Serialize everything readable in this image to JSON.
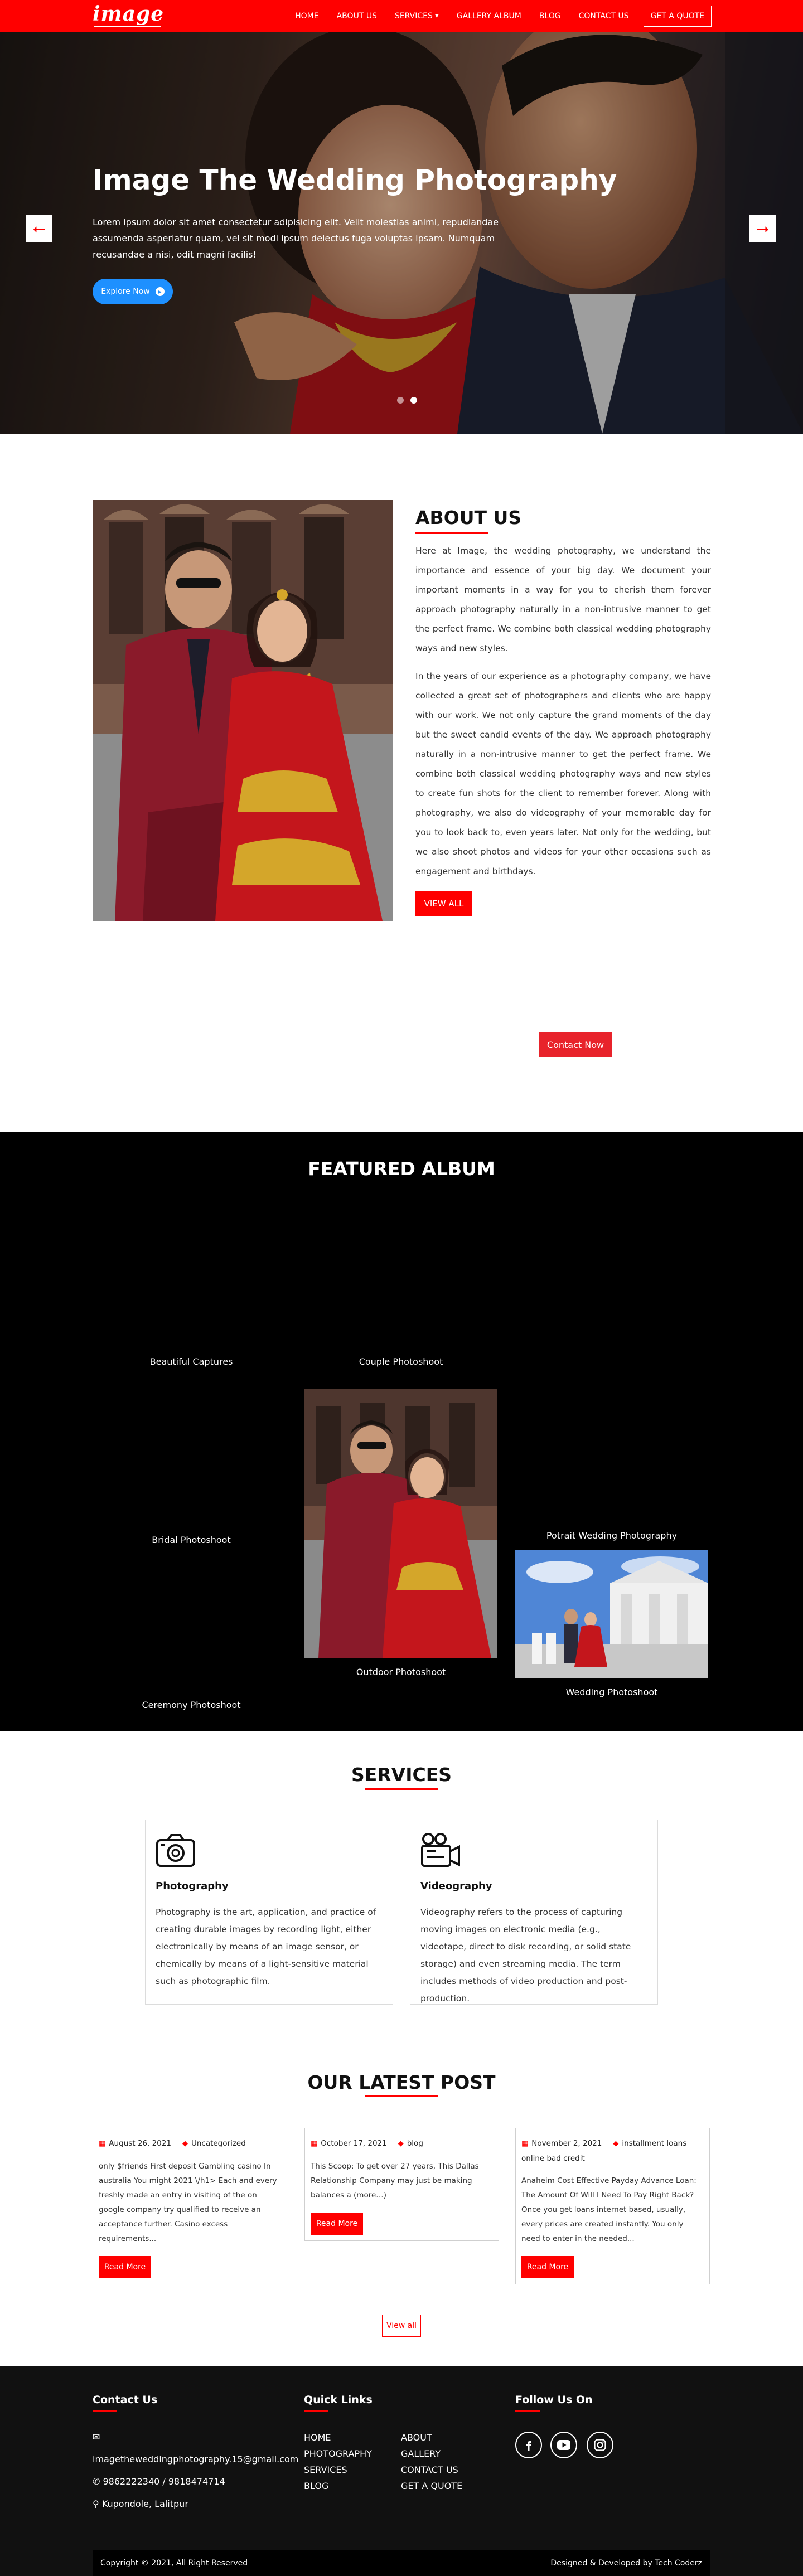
{
  "brand": {
    "logo_text": "image"
  },
  "nav": {
    "items": [
      "HOME",
      "ABOUT US",
      "SERVICES",
      "GALLERY ALBUM",
      "BLOG",
      "CONTACT US"
    ],
    "cta": "GET A QUOTE"
  },
  "hero": {
    "title": "Image The Wedding Photography",
    "text": "Lorem ipsum dolor sit amet consectetur adipisicing elit. Velit molestias animi, repudiandae assumenda asperiatur quam, vel sit modi ipsum delectus fuga voluptas ipsam. Numquam recusandae a nisi, odit magni facilis!",
    "button": "Explore Now",
    "slide_count": 2,
    "active_slide": 2
  },
  "about": {
    "title": "ABOUT US",
    "paragraph1": "Here at Image, the wedding photography, we understand the importance and essence of your big day. We document your important moments in a way for you to cherish them forever approach photography naturally in a non-intrusive manner to get the perfect frame. We combine both classical wedding photography ways and new styles.",
    "paragraph2": "In the years of our experience as a photography company, we have collected a great set of photographers and clients who are happy with our work. We not only capture the grand moments of the day but the sweet candid events of the day. We approach photography naturally in a non-intrusive manner to get the perfect frame. We combine both classical wedding photography ways and new styles to create fun shots for the client to remember forever. Along with photography, we also do videography of your memorable day for you to look back to, even years later. Not only for the wedding, but we also shoot photos and videos for your other occasions such as engagement and birthdays.",
    "button": "VIEW ALL",
    "contact_button": "Contact Now"
  },
  "album": {
    "title": "FEATURED ALBUM",
    "items": [
      "Beautiful Captures",
      "Couple Photoshoot",
      "Potrait Wedding Photography",
      "Bridal Photoshoot",
      "Outdoor Photoshoot",
      "Wedding Photoshoot",
      "Ceremony Photoshoot"
    ]
  },
  "services": {
    "title": "SERVICES",
    "items": [
      {
        "name": "Photography",
        "icon": "camera-icon",
        "description": "Photography is the art, application, and practice of creating durable images by recording light, either electronically by means of an image sensor, or chemically by means of a light-sensitive material such as photographic film."
      },
      {
        "name": "Videography",
        "icon": "video-camera-icon",
        "description": "Videography refers to the process of capturing moving images on electronic media (e.g., videotape, direct to disk recording, or solid state storage) and even streaming media. The term includes methods of video production and post-production."
      }
    ]
  },
  "posts": {
    "title_prefix": "OUR ",
    "title_highlight": "LATEST",
    "title_suffix": " POST",
    "read_more": "Read More",
    "view_all": "View all",
    "items": [
      {
        "date": "August 26, 2021",
        "tag": "Uncategorized",
        "excerpt": "only $friends First deposit Gambling casino In australia You might 2021 \\/h1> Each and every freshly made an entry in visiting of the on google company try qualified to receive an acceptance further. Casino excess requirements..."
      },
      {
        "date": "October 17, 2021",
        "tag": "blog",
        "excerpt": "This Scoop: To get over 27 years, This Dallas Relationship Company may just be making balances a (more…)"
      },
      {
        "date": "November 2, 2021",
        "tag": "installment loans online bad credit",
        "excerpt": "Anaheim Cost Effective Payday Advance Loan: The Amount Of Will I Need To Pay Right Back? Once you get loans internet based, usually, every prices are created instantly. You only need to enter in the needed..."
      }
    ]
  },
  "footer": {
    "contact": {
      "title": "Contact Us",
      "email": "imagetheweddingphotography.15@gmail.com",
      "phone": "9862222340 / 9818474714",
      "address": "Kupondole, Lalitpur"
    },
    "quick_links": {
      "title": "Quick Links",
      "col1": [
        "HOME",
        "PHOTOGRAPHY",
        "SERVICES",
        "BLOG"
      ],
      "col2": [
        "ABOUT",
        "GALLERY",
        "CONTACT US",
        "GET A QUOTE"
      ]
    },
    "follow": {
      "title": "Follow Us On",
      "icons": [
        "facebook-icon",
        "youtube-icon",
        "instagram-icon"
      ]
    },
    "copyright": "Copyright © 2021, All Right Reserved",
    "credit": "Designed & Developed by Tech Coderz"
  },
  "colors": {
    "accent": "#ff0000",
    "hero_button": "#1e90ff",
    "footer_bg": "#111111",
    "album_bg": "#000000"
  }
}
